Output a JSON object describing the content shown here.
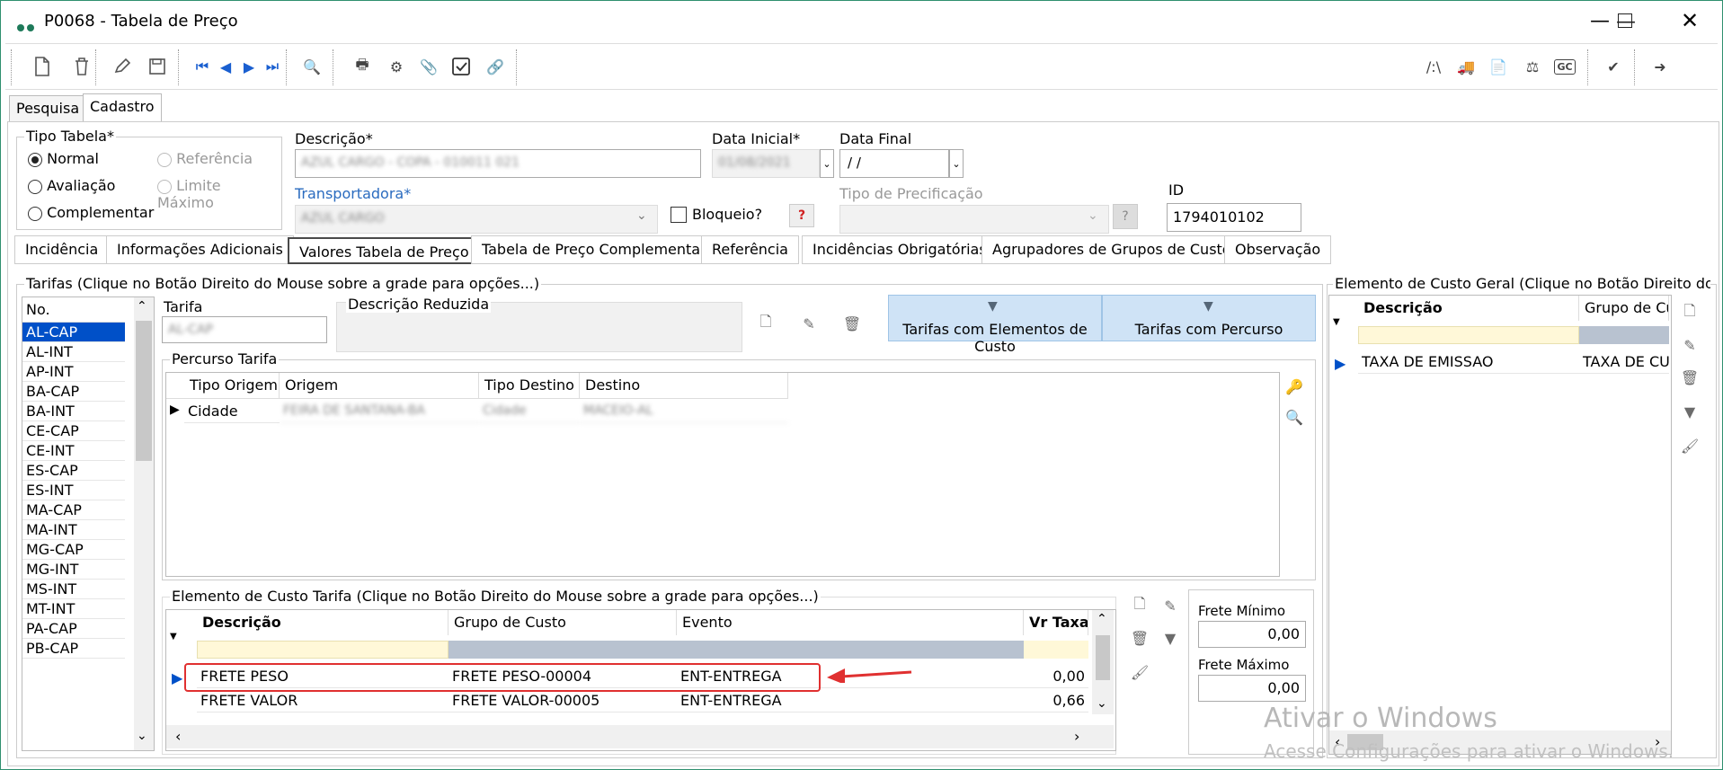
{
  "window": {
    "title": "P0068 - Tabela de Preço"
  },
  "tabs_top": [
    "Pesquisa",
    "Cadastro"
  ],
  "tipo_tabela": {
    "legend": "Tipo Tabela*",
    "options": [
      "Normal",
      "Avaliação",
      "Complementar",
      "Referência",
      "Limite Máximo"
    ],
    "selected": "Normal"
  },
  "fields": {
    "descricao_label": "Descrição*",
    "descricao_value": "AZUL CARGO - COPA - 010011 021",
    "data_inicial_label": "Data Inicial*",
    "data_inicial_value": "01/08/2021",
    "data_final_label": "Data Final",
    "data_final_value": " / /",
    "transportadora_label": "Transportadora*",
    "transportadora_value": "AZUL CARGO",
    "bloqueio_label": "Bloqueio?",
    "help_glyph": "?",
    "tipo_precificacao_label": "Tipo de Precificação",
    "id_label": "ID",
    "id_value": "1794010102"
  },
  "detail_tabs": [
    "Incidência",
    "Informações Adicionais",
    "Valores Tabela de Preço",
    "Tabela de Preço Complementar",
    "Referência",
    "Incidências Obrigatórias",
    "Agrupadores de Grupos de Custo",
    "Observação"
  ],
  "tarifas": {
    "legend": "Tarifas   (Clique no Botão Direito do Mouse sobre a grade para opções...)",
    "col": "No.",
    "items": [
      "AL-CAP",
      "AL-INT",
      "AP-INT",
      "BA-CAP",
      "BA-INT",
      "CE-CAP",
      "CE-INT",
      "ES-CAP",
      "ES-INT",
      "MA-CAP",
      "MA-INT",
      "MG-CAP",
      "MG-INT",
      "MS-INT",
      "MT-INT",
      "PA-CAP",
      "PB-CAP"
    ],
    "selected": "AL-CAP"
  },
  "tarifa_form": {
    "tarifa_label": "Tarifa",
    "tarifa_value": "AL-CAP",
    "desc_reduzida_label": "Descrição Reduzida",
    "btn_elementos": "Tarifas com Elementos de Custo",
    "btn_percurso": "Tarifas com Percurso"
  },
  "percurso": {
    "legend": "Percurso Tarifa",
    "cols": [
      "Tipo Origem",
      "Origem",
      "Tipo Destino",
      "Destino"
    ],
    "row": {
      "tipo_origem": "Cidade",
      "origem": "FEIRA DE SANTANA-BA",
      "tipo_destino": "Cidade",
      "destino": "MACEIO-AL"
    }
  },
  "elemento_tarifa": {
    "legend": "Elemento de Custo Tarifa   (Clique no Botão Direito do Mouse sobre a grade para opções...)",
    "cols": [
      "Descrição",
      "Grupo de Custo",
      "Evento",
      "Vr Taxa"
    ],
    "rows": [
      {
        "descricao": "FRETE PESO",
        "grupo": "FRETE PESO-00004",
        "evento": "ENT-ENTREGA",
        "vr": "0,00"
      },
      {
        "descricao": "FRETE VALOR",
        "grupo": "FRETE VALOR-00005",
        "evento": "ENT-ENTREGA",
        "vr": "0,66"
      }
    ]
  },
  "frete": {
    "min_label": "Frete Mínimo",
    "min_value": "0,00",
    "max_label": "Frete Máximo",
    "max_value": "0,00"
  },
  "elemento_geral": {
    "legend": "Elemento de Custo Geral   (Clique no Botão Direito do Mouse sobre a grade para opções...)",
    "cols": [
      "Descrição",
      "Grupo de Custo"
    ],
    "rows": [
      {
        "descricao": "TAXA DE EMISSAO",
        "grupo": "TAXA DE CUSTO"
      }
    ]
  },
  "watermark": {
    "line1": "Ativar o Windows",
    "line2": "Acesse Configurações para ativar o Windows."
  },
  "colors": {
    "accent": "#1e7a5a",
    "highlight_box": "#e03030",
    "selection_blue": "#0050c8",
    "filter_bg": "#cfe3f6"
  }
}
